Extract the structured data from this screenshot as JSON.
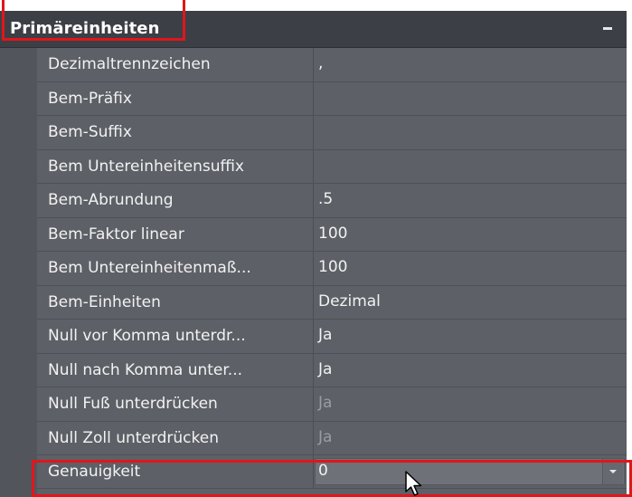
{
  "panel": {
    "title": "Primäreinheiten",
    "colors": {
      "highlight": "#e0161b",
      "panel_bg": "#5d6066",
      "header_bg": "#3c3f45"
    }
  },
  "rows": [
    {
      "label": "Dezimaltrennzeichen",
      "value": ",",
      "disabled": false
    },
    {
      "label": "Bem-Präfix",
      "value": "",
      "disabled": false
    },
    {
      "label": "Bem-Suffix",
      "value": "",
      "disabled": false
    },
    {
      "label": "Bem Untereinheitensuffix",
      "value": "",
      "disabled": false
    },
    {
      "label": "Bem-Abrundung",
      "value": ".5",
      "disabled": false
    },
    {
      "label": "Bem-Faktor linear",
      "value": "100",
      "disabled": false
    },
    {
      "label": "Bem  Untereinheitenmaß...",
      "value": "100",
      "disabled": false
    },
    {
      "label": "Bem-Einheiten",
      "value": "Dezimal",
      "disabled": false
    },
    {
      "label": "Null vor Komma unterdr...",
      "value": "Ja",
      "disabled": false
    },
    {
      "label": "Null nach Komma unter...",
      "value": "Ja",
      "disabled": false
    },
    {
      "label": "Null Fuß unterdrücken",
      "value": "Ja",
      "disabled": true
    },
    {
      "label": "Null Zoll unterdrücken",
      "value": "Ja",
      "disabled": true
    }
  ],
  "selected_row": {
    "label": "Genauigkeit",
    "value": "0"
  }
}
